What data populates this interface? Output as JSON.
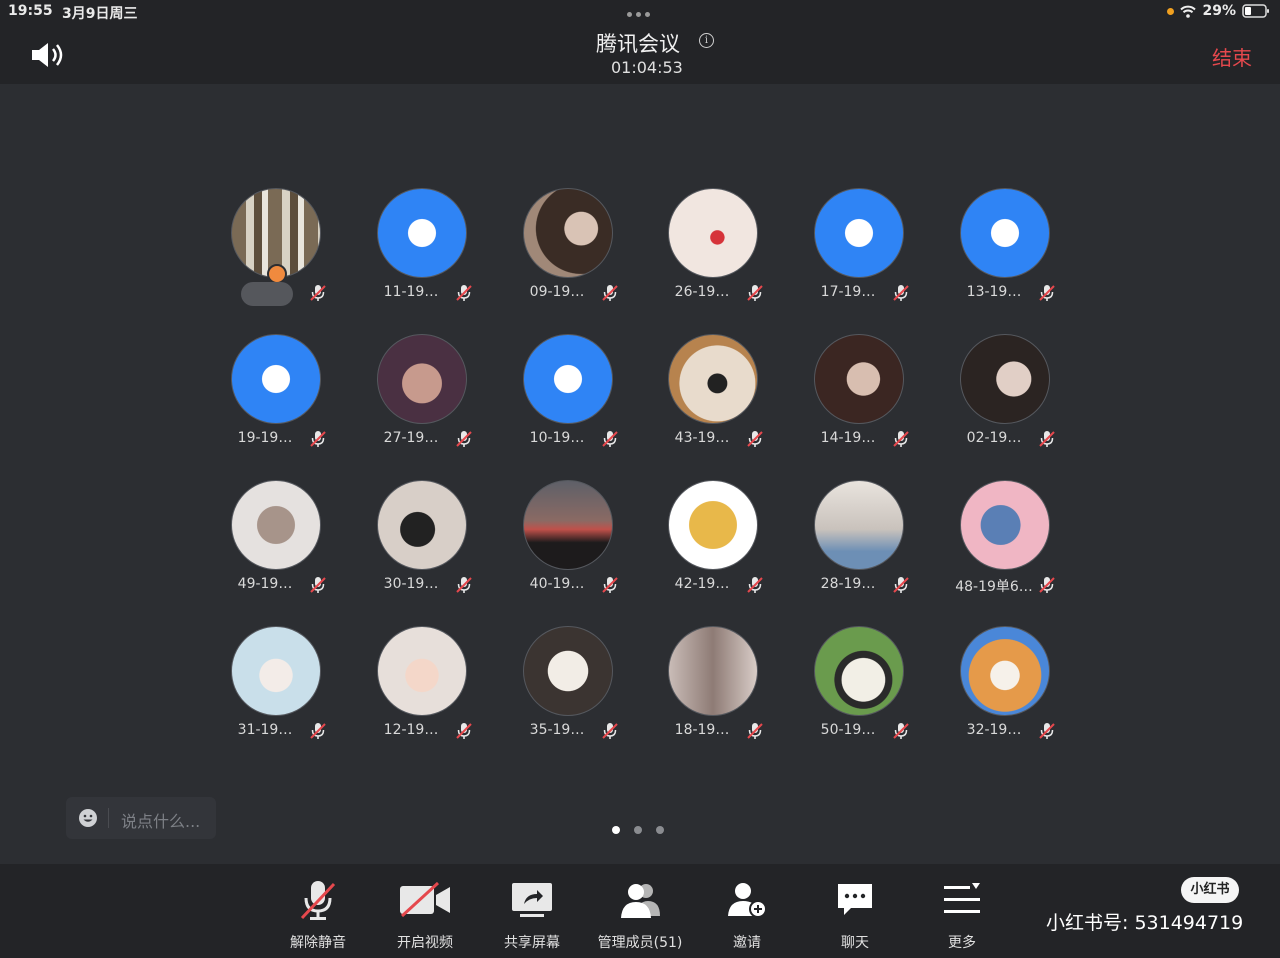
{
  "status_bar": {
    "time": "19:55",
    "date": "3月9日周三",
    "battery": "29%"
  },
  "header": {
    "title": "腾讯会议",
    "timer": "01:04:53",
    "end_label": "结束"
  },
  "participants": [
    {
      "name": "",
      "avatar": "bookshelf",
      "host": true
    },
    {
      "name": "11-19…",
      "avatar": "blue-default"
    },
    {
      "name": "09-19…",
      "avatar": "couple-photo"
    },
    {
      "name": "26-19…",
      "avatar": "strawberry-girl"
    },
    {
      "name": "17-19…",
      "avatar": "blue-default"
    },
    {
      "name": "13-19…",
      "avatar": "blue-default"
    },
    {
      "name": "19-19…",
      "avatar": "blue-default"
    },
    {
      "name": "27-19…",
      "avatar": "man-portrait"
    },
    {
      "name": "10-19…",
      "avatar": "blue-default"
    },
    {
      "name": "43-19…",
      "avatar": "dog-closeup"
    },
    {
      "name": "14-19…",
      "avatar": "couple-dark"
    },
    {
      "name": "02-19…",
      "avatar": "couple-selfie"
    },
    {
      "name": "49-19…",
      "avatar": "man-hiding"
    },
    {
      "name": "30-19…",
      "avatar": "person-dog"
    },
    {
      "name": "40-19…",
      "avatar": "sunset"
    },
    {
      "name": "42-19…",
      "avatar": "doge-meme"
    },
    {
      "name": "28-19…",
      "avatar": "girl-sitting"
    },
    {
      "name": "48-19单6…",
      "avatar": "tom-cat"
    },
    {
      "name": "31-19…",
      "avatar": "anime-girl"
    },
    {
      "name": "12-19…",
      "avatar": "anime-boy"
    },
    {
      "name": "35-19…",
      "avatar": "puppy"
    },
    {
      "name": "18-19…",
      "avatar": "girl-hallway"
    },
    {
      "name": "50-19…",
      "avatar": "shaun-sheep"
    },
    {
      "name": "32-19…",
      "avatar": "shiba"
    }
  ],
  "chat": {
    "placeholder": "说点什么..."
  },
  "toolbar": {
    "unmute": "解除静音",
    "video": "开启视频",
    "share": "共享屏幕",
    "members": "管理成员(51)",
    "invite": "邀请",
    "chat": "聊天",
    "more": "更多"
  },
  "watermark": {
    "logo": "小红书",
    "text": "小红书号: 531494719"
  }
}
